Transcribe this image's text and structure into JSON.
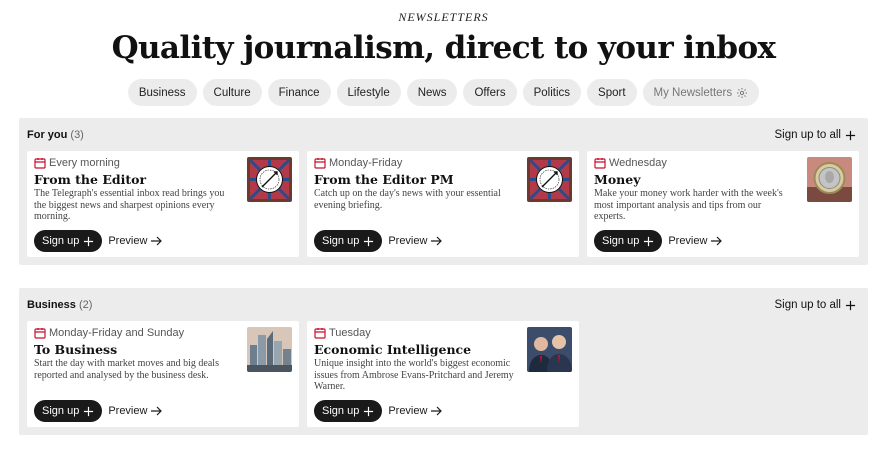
{
  "header": {
    "kicker": "NEWSLETTERS",
    "headline": "Quality journalism, direct to your inbox"
  },
  "filters": [
    {
      "label": "Business"
    },
    {
      "label": "Culture"
    },
    {
      "label": "Finance"
    },
    {
      "label": "Lifestyle"
    },
    {
      "label": "News"
    },
    {
      "label": "Offers"
    },
    {
      "label": "Politics"
    },
    {
      "label": "Sport"
    },
    {
      "label": "My Newsletters",
      "icon": "gear-icon"
    }
  ],
  "sections": [
    {
      "title": "For you",
      "count": "(3)",
      "signup_all": "Sign up to all",
      "cards": [
        {
          "frequency": "Every morning",
          "title": "From the Editor",
          "description": "The Telegraph's essential inbox read brings you the biggest news and sharpest opinions every morning.",
          "thumb": "editor-badge-image",
          "signup_label": "Sign up",
          "preview_label": "Preview"
        },
        {
          "frequency": "Monday-Friday",
          "title": "From the Editor PM",
          "description": "Catch up on the day's news with your essential evening briefing.",
          "thumb": "editor-badge-image",
          "signup_label": "Sign up",
          "preview_label": "Preview"
        },
        {
          "frequency": "Wednesday",
          "title": "Money",
          "description": "Make your money work harder with the week's most important analysis and tips from our experts.",
          "thumb": "pound-coin-image",
          "signup_label": "Sign up",
          "preview_label": "Preview"
        }
      ]
    },
    {
      "title": "Business",
      "count": "(2)",
      "signup_all": "Sign up to all",
      "cards": [
        {
          "frequency": "Monday-Friday and Sunday",
          "title": "To Business",
          "description": "Start the day with market moves and big deals reported and analysed by the business desk.",
          "thumb": "city-skyline-image",
          "signup_label": "Sign up",
          "preview_label": "Preview"
        },
        {
          "frequency": "Tuesday",
          "title": "Economic Intelligence",
          "description": "Unique insight into the world's biggest economic issues from Ambrose Evans-Pritchard and Jeremy Warner.",
          "thumb": "authors-portrait-image",
          "signup_label": "Sign up",
          "preview_label": "Preview"
        }
      ]
    }
  ],
  "colors": {
    "accent_red": "#c8102e",
    "section_bg": "#ececec",
    "button_dark": "#1a1a1a"
  }
}
